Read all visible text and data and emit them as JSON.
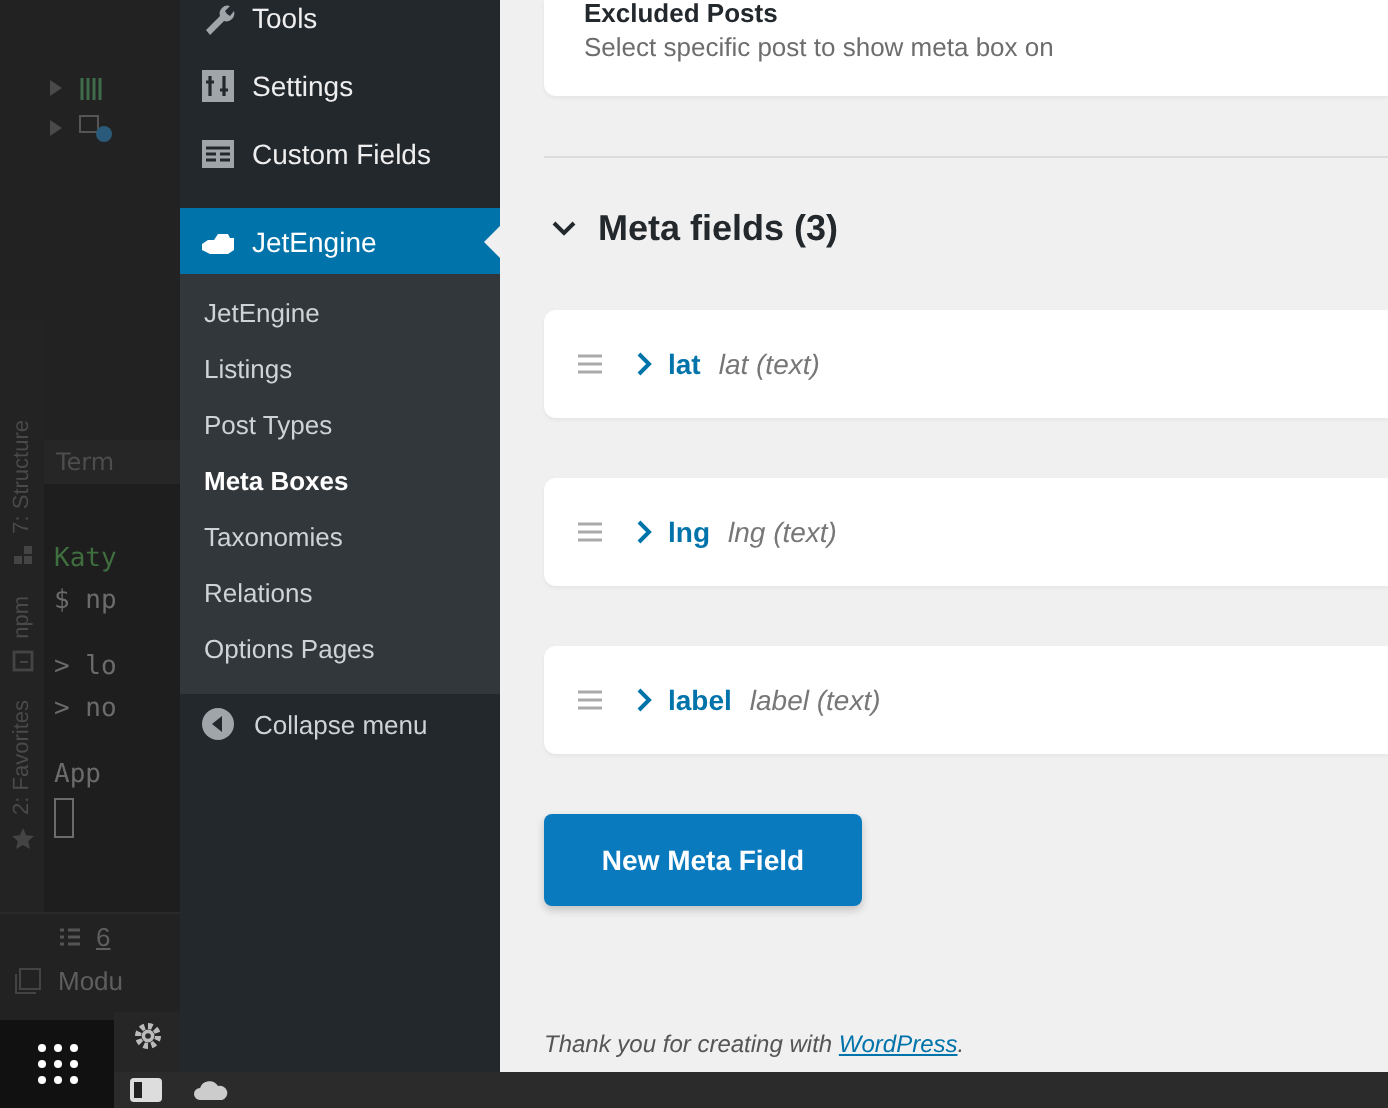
{
  "ide": {
    "tool_windows": [
      "7: Structure",
      "npm",
      "2: Favorites"
    ],
    "terminal": {
      "tab": "Term",
      "blocks": [
        [
          {
            "text": "Katy",
            "kind": "user"
          },
          {
            "text": "$ np",
            "kind": "command"
          }
        ],
        [
          {
            "text": "> lo",
            "kind": "output"
          },
          {
            "text": "> no",
            "kind": "output"
          }
        ],
        [
          {
            "text": "App",
            "kind": "output"
          }
        ]
      ]
    },
    "bottom_tabs": [
      "6",
      "Modu"
    ]
  },
  "admin_menu": {
    "items": [
      {
        "label": "Tools",
        "selected": false
      },
      {
        "label": "Settings",
        "selected": false
      },
      {
        "label": "Custom Fields",
        "selected": false
      },
      {
        "label": "JetEngine",
        "selected": true
      }
    ],
    "submenu": [
      {
        "label": "JetEngine",
        "selected": false
      },
      {
        "label": "Listings",
        "selected": false
      },
      {
        "label": "Post Types",
        "selected": false
      },
      {
        "label": "Meta Boxes",
        "selected": true
      },
      {
        "label": "Taxonomies",
        "selected": false
      },
      {
        "label": "Relations",
        "selected": false
      },
      {
        "label": "Options Pages",
        "selected": false
      }
    ],
    "collapse": "Collapse menu"
  },
  "excluded_posts": {
    "title": "Excluded Posts",
    "description": "Select specific post to show meta box on"
  },
  "meta_fields": {
    "title": "Meta fields (3)",
    "expanded": true,
    "fields": [
      {
        "name": "lat",
        "type": "lat (text)",
        "expanded": false
      },
      {
        "name": "lng",
        "type": "lng (text)",
        "expanded": false
      },
      {
        "name": "label",
        "type": "label (text)",
        "expanded": false
      }
    ],
    "button": "New Meta Field"
  },
  "footer": {
    "before": "Thank you for creating with ",
    "link": "WordPress",
    "after": "."
  }
}
